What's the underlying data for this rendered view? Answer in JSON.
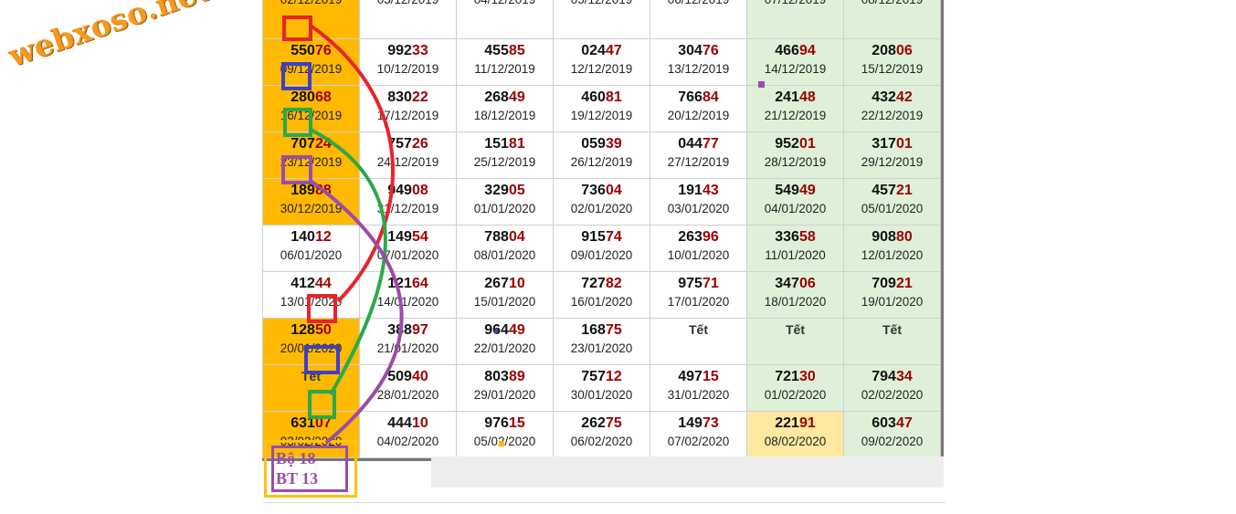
{
  "watermark": "webxoso.net",
  "rows": [
    [
      {
        "n": "",
        "d": "02/12/2019",
        "s": "hl"
      },
      {
        "n": "",
        "d": "03/12/2019"
      },
      {
        "n": "",
        "d": "04/12/2019"
      },
      {
        "n": "",
        "d": "05/12/2019"
      },
      {
        "n": "",
        "d": "06/12/2019"
      },
      {
        "n": "",
        "d": "07/12/2019",
        "s": "wk"
      },
      {
        "n": "",
        "d": "08/12/2019",
        "s": "wk"
      }
    ],
    [
      {
        "n": "55076",
        "d": "09/12/2019",
        "s": "hl"
      },
      {
        "n": "99233",
        "d": "10/12/2019"
      },
      {
        "n": "45585",
        "d": "11/12/2019"
      },
      {
        "n": "02447",
        "d": "12/12/2019"
      },
      {
        "n": "30476",
        "d": "13/12/2019"
      },
      {
        "n": "46694",
        "d": "14/12/2019",
        "s": "wk"
      },
      {
        "n": "20806",
        "d": "15/12/2019",
        "s": "wk"
      }
    ],
    [
      {
        "n": "28068",
        "d": "16/12/2019",
        "s": "hl"
      },
      {
        "n": "83022",
        "d": "17/12/2019"
      },
      {
        "n": "26849",
        "d": "18/12/2019"
      },
      {
        "n": "46081",
        "d": "19/12/2019"
      },
      {
        "n": "76684",
        "d": "20/12/2019"
      },
      {
        "n": "24148",
        "d": "21/12/2019",
        "s": "wk"
      },
      {
        "n": "43242",
        "d": "22/12/2019",
        "s": "wk"
      }
    ],
    [
      {
        "n": "70724",
        "d": "23/12/2019",
        "s": "hl"
      },
      {
        "n": "75726",
        "d": "24/12/2019"
      },
      {
        "n": "15181",
        "d": "25/12/2019"
      },
      {
        "n": "05939",
        "d": "26/12/2019"
      },
      {
        "n": "04477",
        "d": "27/12/2019"
      },
      {
        "n": "95201",
        "d": "28/12/2019",
        "s": "wk"
      },
      {
        "n": "31701",
        "d": "29/12/2019",
        "s": "wk"
      }
    ],
    [
      {
        "n": "18988",
        "d": "30/12/2019",
        "s": "hl"
      },
      {
        "n": "94908",
        "d": "31/12/2019"
      },
      {
        "n": "32905",
        "d": "01/01/2020"
      },
      {
        "n": "73604",
        "d": "02/01/2020"
      },
      {
        "n": "19143",
        "d": "03/01/2020"
      },
      {
        "n": "54949",
        "d": "04/01/2020",
        "s": "wk"
      },
      {
        "n": "45721",
        "d": "05/01/2020",
        "s": "wk"
      }
    ],
    [
      {
        "n": "14012",
        "d": "06/01/2020"
      },
      {
        "n": "14954",
        "d": "07/01/2020"
      },
      {
        "n": "78804",
        "d": "08/01/2020"
      },
      {
        "n": "91574",
        "d": "09/01/2020"
      },
      {
        "n": "26396",
        "d": "10/01/2020"
      },
      {
        "n": "33658",
        "d": "11/01/2020",
        "s": "wk"
      },
      {
        "n": "90880",
        "d": "12/01/2020",
        "s": "wk"
      }
    ],
    [
      {
        "n": "41244",
        "d": "13/01/2020"
      },
      {
        "n": "12164",
        "d": "14/01/2020"
      },
      {
        "n": "26710",
        "d": "15/01/2020"
      },
      {
        "n": "72782",
        "d": "16/01/2020"
      },
      {
        "n": "97571",
        "d": "17/01/2020"
      },
      {
        "n": "34706",
        "d": "18/01/2020",
        "s": "wk"
      },
      {
        "n": "70921",
        "d": "19/01/2020",
        "s": "wk"
      }
    ],
    [
      {
        "n": "12850",
        "d": "20/01/2020",
        "s": "hl"
      },
      {
        "n": "38897",
        "d": "21/01/2020"
      },
      {
        "n": "96449",
        "d": "22/01/2020"
      },
      {
        "n": "16875",
        "d": "23/01/2020"
      },
      {
        "n": "Tết",
        "d": "",
        "tet": true
      },
      {
        "n": "Tết",
        "d": "",
        "s": "wk",
        "tet": true
      },
      {
        "n": "Tết",
        "d": "",
        "s": "wk",
        "tet": true
      }
    ],
    [
      {
        "n": "Tết",
        "d": "",
        "s": "hl",
        "tet": true
      },
      {
        "n": "50940",
        "d": "28/01/2020"
      },
      {
        "n": "80389",
        "d": "29/01/2020"
      },
      {
        "n": "75712",
        "d": "30/01/2020"
      },
      {
        "n": "49715",
        "d": "31/01/2020"
      },
      {
        "n": "72130",
        "d": "01/02/2020",
        "s": "wk"
      },
      {
        "n": "79434",
        "d": "02/02/2020",
        "s": "wk"
      }
    ],
    [
      {
        "n": "63107",
        "d": "03/02/2020",
        "s": "hl"
      },
      {
        "n": "44410",
        "d": "04/02/2020"
      },
      {
        "n": "97615",
        "d": "05/02/2020"
      },
      {
        "n": "26275",
        "d": "06/02/2020"
      },
      {
        "n": "14973",
        "d": "07/02/2020"
      },
      {
        "n": "22191",
        "d": "08/02/2020",
        "s": "yl"
      },
      {
        "n": "60347",
        "d": "09/02/2020",
        "s": "wk"
      }
    ]
  ],
  "annotation": {
    "line1": "Bộ 18",
    "line2": "BT 13"
  },
  "colors": {
    "red": "#e8242b",
    "blue": "#3f3fc4",
    "green": "#2ca84a",
    "purple": "#9b4ca8",
    "orange": "#ffb900"
  }
}
